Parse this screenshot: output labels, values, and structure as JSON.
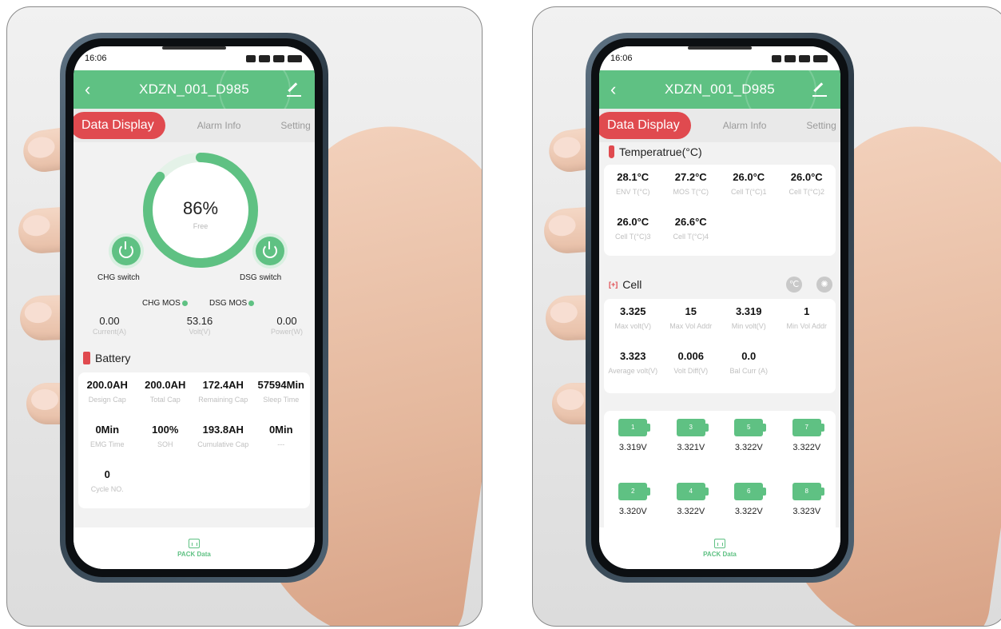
{
  "phone_left": {
    "status_time": "16:06",
    "header": {
      "title": "XDZN_001_D985"
    },
    "tabs": {
      "active": "Data Display",
      "t2": "Alarm Info",
      "t3": "Setting"
    },
    "ring": {
      "percent_text": "86%",
      "sub": "Free",
      "fraction": 0.86
    },
    "chg_switch": "CHG switch",
    "dsg_switch": "DSG switch",
    "chg_mos": "CHG MOS",
    "dsg_mos": "DSG MOS",
    "metrics": [
      {
        "value": "0.00",
        "label": "Current(A)"
      },
      {
        "value": "53.16",
        "label": "Volt(V)"
      },
      {
        "value": "0.00",
        "label": "Power(W)"
      }
    ],
    "battery_title": "Battery",
    "battery": [
      {
        "value": "200.0AH",
        "label": "Design Cap"
      },
      {
        "value": "200.0AH",
        "label": "Total Cap"
      },
      {
        "value": "172.4AH",
        "label": "Remaining Cap"
      },
      {
        "value": "57594Min",
        "label": "Sleep Time"
      },
      {
        "value": "0Min",
        "label": "EMG Time"
      },
      {
        "value": "100%",
        "label": "SOH"
      },
      {
        "value": "193.8AH",
        "label": "Cumulative Cap"
      },
      {
        "value": "0Min",
        "label": "---"
      },
      {
        "value": "0",
        "label": "Cycle NO."
      }
    ],
    "nav_label": "PACK Data"
  },
  "phone_right": {
    "status_time": "16:06",
    "header": {
      "title": "XDZN_001_D985"
    },
    "tabs": {
      "active": "Data Display",
      "t2": "Alarm Info",
      "t3": "Setting"
    },
    "temp_title": "Temperatrue(°C)",
    "temps": [
      {
        "value": "28.1°C",
        "label": "ENV T(°C)"
      },
      {
        "value": "27.2°C",
        "label": "MOS T(°C)"
      },
      {
        "value": "26.0°C",
        "label": "Cell T(°C)1"
      },
      {
        "value": "26.0°C",
        "label": "Cell T(°C)2"
      },
      {
        "value": "26.0°C",
        "label": "Cell T(°C)3"
      },
      {
        "value": "26.6°C",
        "label": "Cell T(°C)4"
      }
    ],
    "cell_title": "Cell",
    "cell_stats": [
      {
        "value": "3.325",
        "label": "Max volt(V)"
      },
      {
        "value": "15",
        "label": "Max Vol Addr"
      },
      {
        "value": "3.319",
        "label": "Min volt(V)"
      },
      {
        "value": "1",
        "label": "Min Vol Addr"
      },
      {
        "value": "3.323",
        "label": "Average volt(V)"
      },
      {
        "value": "0.006",
        "label": "Volt Diff(V)"
      },
      {
        "value": "0.0",
        "label": "Bal Curr (A)"
      }
    ],
    "cells": [
      {
        "id": "1",
        "volt": "3.319V"
      },
      {
        "id": "3",
        "volt": "3.321V"
      },
      {
        "id": "5",
        "volt": "3.322V"
      },
      {
        "id": "7",
        "volt": "3.322V"
      },
      {
        "id": "2",
        "volt": "3.320V"
      },
      {
        "id": "4",
        "volt": "3.322V"
      },
      {
        "id": "6",
        "volt": "3.322V"
      },
      {
        "id": "8",
        "volt": "3.323V"
      }
    ],
    "nav_label": "PACK Data"
  },
  "colors": {
    "accent": "#5fc183",
    "active_tab": "#e04a4f"
  }
}
